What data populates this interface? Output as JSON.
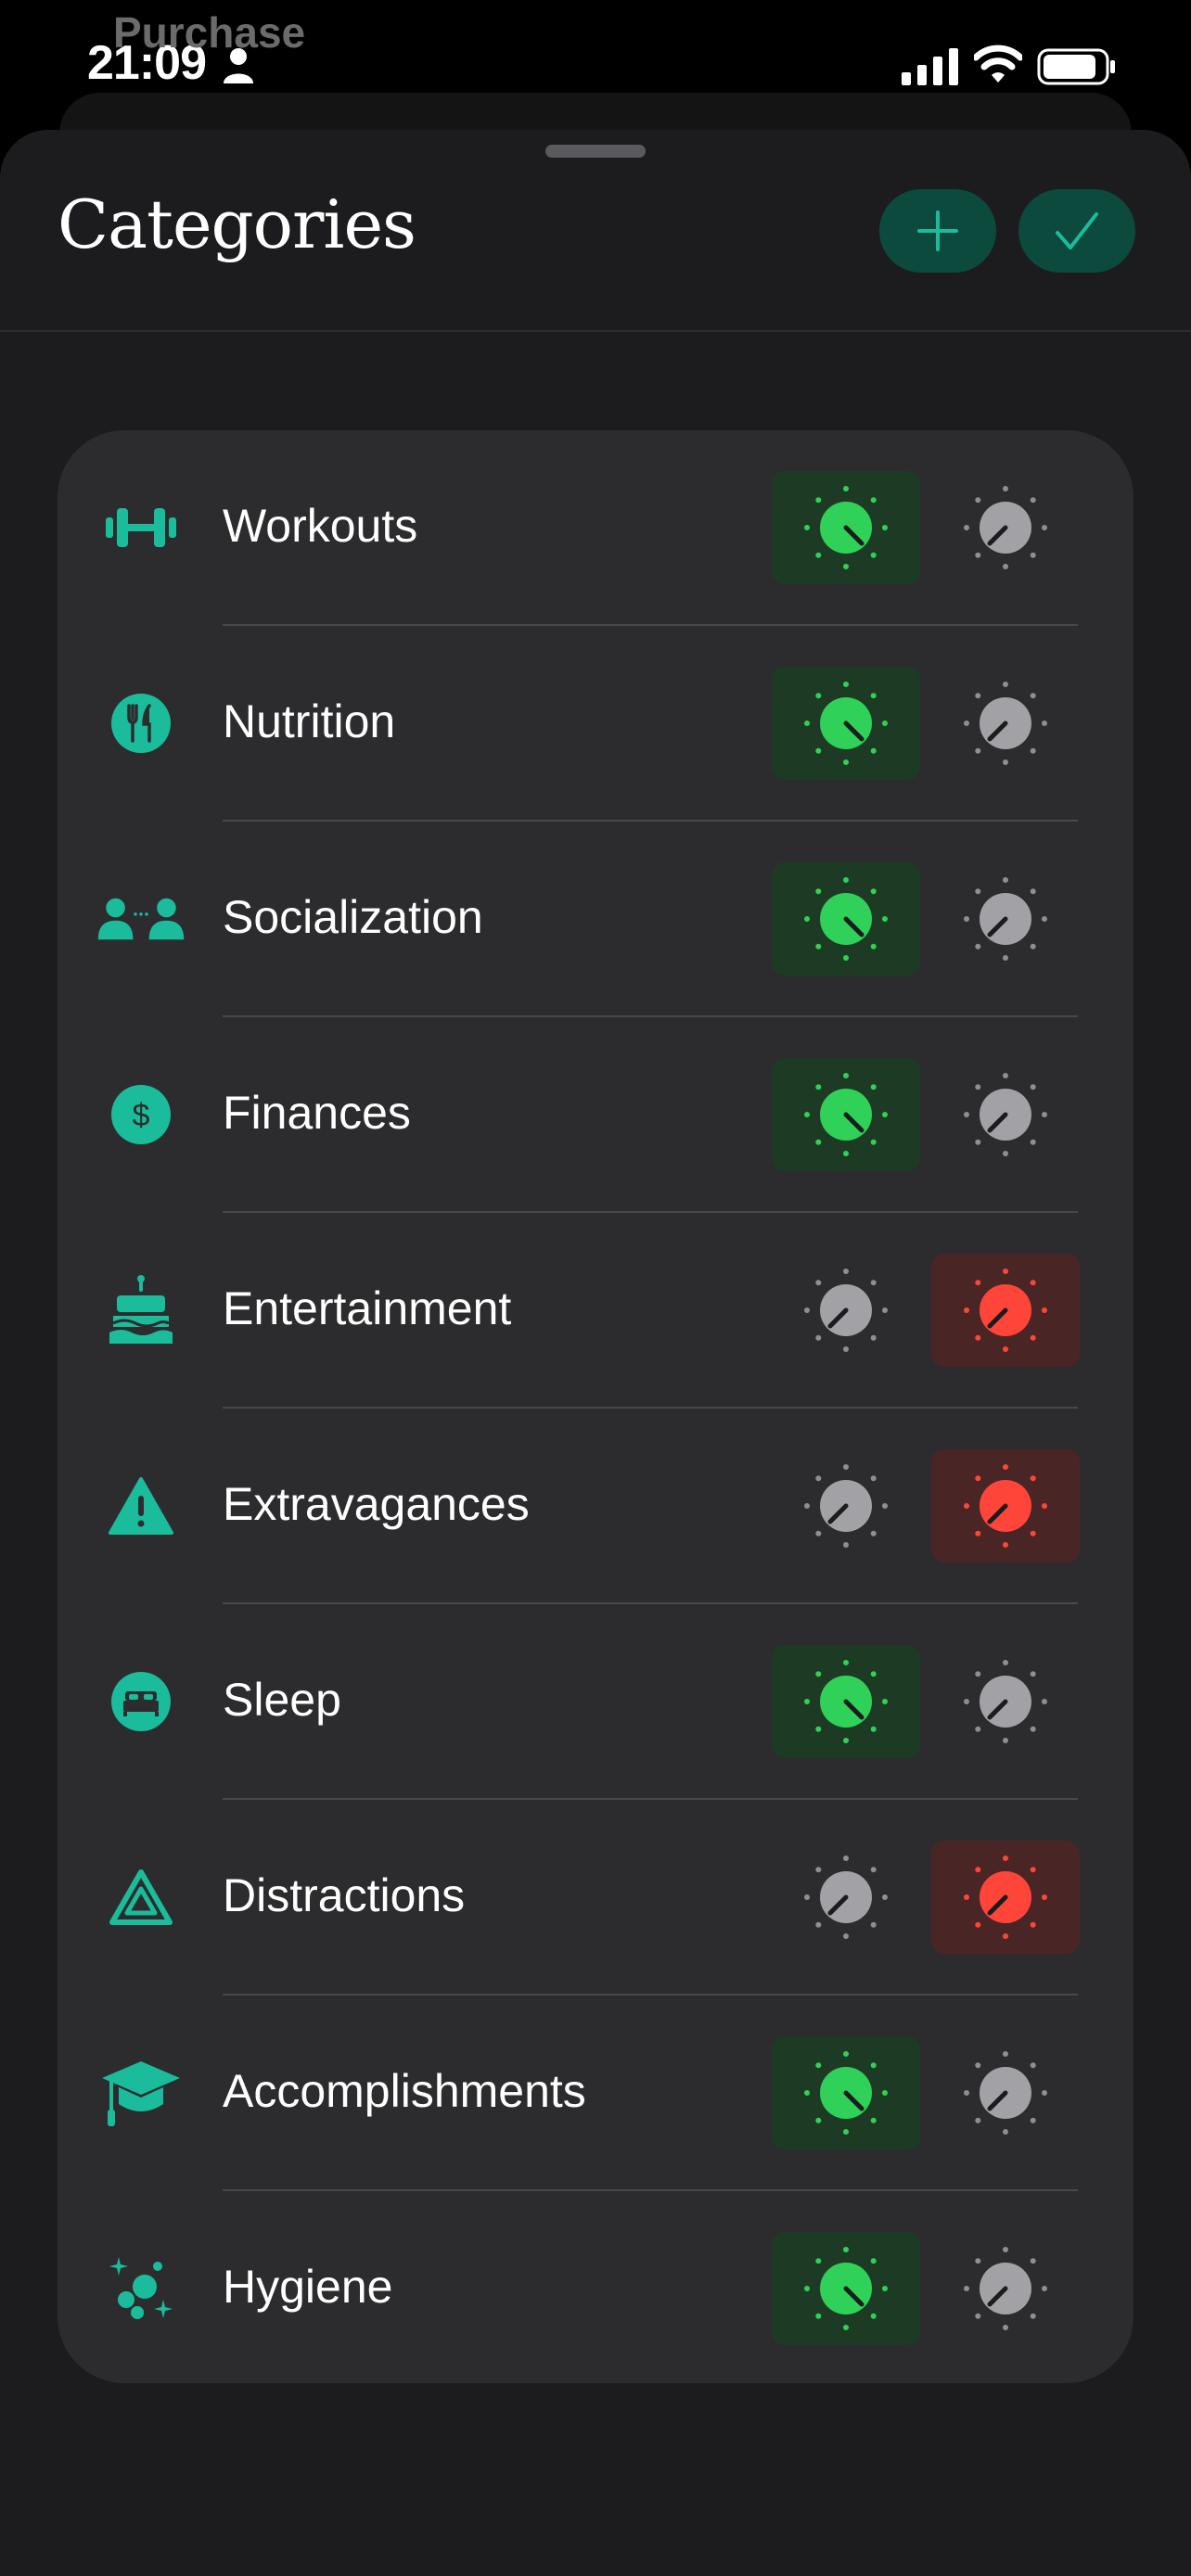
{
  "status_bar": {
    "time": "21:09",
    "behind_title": "Purchase"
  },
  "sheet": {
    "title": "Categories",
    "add_label": "+",
    "done_label": "✓"
  },
  "colors": {
    "accent": "#1abc9c",
    "positive": "#30d158",
    "negative": "#ff453a",
    "neutral": "#a1a1a6"
  },
  "categories": [
    {
      "label": "Workouts",
      "icon": "dumbbell-icon",
      "selected": "positive"
    },
    {
      "label": "Nutrition",
      "icon": "fork-knife-icon",
      "selected": "positive"
    },
    {
      "label": "Socialization",
      "icon": "people-icon",
      "selected": "positive"
    },
    {
      "label": "Finances",
      "icon": "dollar-icon",
      "selected": "positive"
    },
    {
      "label": "Entertainment",
      "icon": "birthday-cake-icon",
      "selected": "negative"
    },
    {
      "label": "Extravagances",
      "icon": "warning-icon",
      "selected": "negative"
    },
    {
      "label": "Sleep",
      "icon": "bed-icon",
      "selected": "positive"
    },
    {
      "label": "Distractions",
      "icon": "triangle-alert-icon",
      "selected": "negative"
    },
    {
      "label": "Accomplishments",
      "icon": "graduation-cap-icon",
      "selected": "positive"
    },
    {
      "label": "Hygiene",
      "icon": "bubbles-icon",
      "selected": "positive"
    }
  ]
}
